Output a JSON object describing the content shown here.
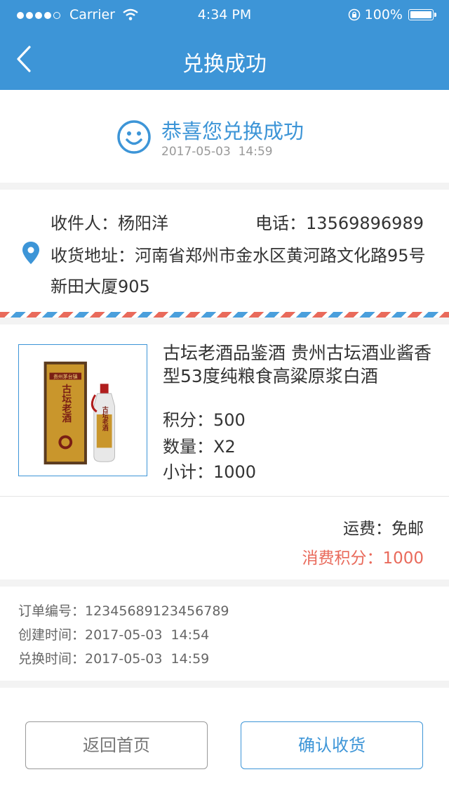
{
  "status_bar": {
    "carrier": "Carrier",
    "time": "4:34 PM",
    "battery": "100%"
  },
  "nav": {
    "title": "兑换成功"
  },
  "success": {
    "message": "恭喜您兑换成功",
    "time": "2017-05-03  14:59"
  },
  "address": {
    "receiver": "收件人：杨阳洋",
    "phone": "电话：13569896989",
    "address": "收货地址：河南省郑州市金水区黄河路文化路95号新田大厦905"
  },
  "product": {
    "name": "古坛老酒品鉴酒 贵州古坛酒业酱香型53度纯粮食高粱原浆白酒",
    "points": "积分：500",
    "quantity": "数量：X2",
    "subtotal": "小计：1000",
    "image_text": {
      "brand": "古坛老酒",
      "banner": "贵州茅台镇",
      "label": "古坛老酒"
    }
  },
  "totals": {
    "shipping": "运费：免邮",
    "points_spent": "消费积分：1000"
  },
  "order": {
    "number": "订单编号：12345689123456789",
    "created": "创建时间：2017-05-03  14:54",
    "exchanged": "兑换时间：2017-05-03  14:59"
  },
  "buttons": {
    "home": "返回首页",
    "confirm": "确认收货"
  },
  "colors": {
    "accent": "#3d95d7",
    "highlight": "#e96a5b"
  }
}
